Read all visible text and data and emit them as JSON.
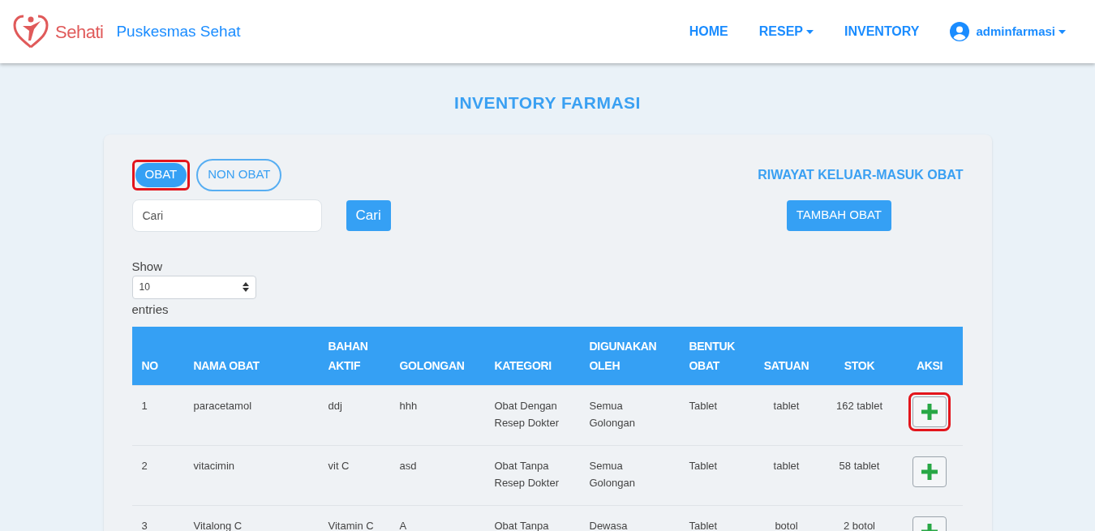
{
  "navbar": {
    "logo_text": "Sehati",
    "brand": "Puskesmas Sehat",
    "links": [
      {
        "label": "HOME",
        "dropdown": false
      },
      {
        "label": "RESEP",
        "dropdown": true
      },
      {
        "label": "INVENTORY",
        "dropdown": false
      }
    ],
    "user": {
      "label": "adminfarmasi",
      "dropdown": true
    }
  },
  "page_title": "INVENTORY FARMASI",
  "tabs": [
    {
      "label": "OBAT",
      "selected": true,
      "highlighted": true
    },
    {
      "label": "NON OBAT",
      "selected": false,
      "highlighted": false
    }
  ],
  "history_link": "RIWAYAT KELUAR-MASUK OBAT",
  "search": {
    "placeholder": "Cari",
    "button": "Cari"
  },
  "add_button": "TAMBAH OBAT",
  "length": {
    "before": "Show",
    "value": "10",
    "after": "entries"
  },
  "table": {
    "columns": [
      {
        "lines": [
          "NO"
        ]
      },
      {
        "lines": [
          "NAMA OBAT"
        ]
      },
      {
        "lines": [
          "BAHAN",
          "AKTIF"
        ]
      },
      {
        "lines": [
          "GOLONGAN"
        ]
      },
      {
        "lines": [
          "KATEGORI"
        ]
      },
      {
        "lines": [
          "DIGUNAKAN",
          "OLEH"
        ]
      },
      {
        "lines": [
          "BENTUK",
          "OBAT"
        ]
      },
      {
        "lines": [
          "SATUAN"
        ]
      },
      {
        "lines": [
          "STOK"
        ]
      },
      {
        "lines": [
          "AKSI"
        ]
      }
    ],
    "rows": [
      {
        "cells": [
          [
            "1"
          ],
          [
            "paracetamol"
          ],
          [
            "ddj"
          ],
          [
            "hhh"
          ],
          [
            "Obat Dengan",
            "Resep Dokter"
          ],
          [
            "Semua",
            "Golongan"
          ],
          [
            "Tablet"
          ],
          [
            "tablet"
          ],
          [
            "162 tablet"
          ]
        ],
        "highlighted": true
      },
      {
        "cells": [
          [
            "2"
          ],
          [
            "vitacimin"
          ],
          [
            "vit C"
          ],
          [
            "asd"
          ],
          [
            "Obat Tanpa",
            "Resep Dokter"
          ],
          [
            "Semua",
            "Golongan"
          ],
          [
            "Tablet"
          ],
          [
            "tablet"
          ],
          [
            "58 tablet"
          ]
        ],
        "highlighted": false
      },
      {
        "cells": [
          [
            "3"
          ],
          [
            "Vitalong C"
          ],
          [
            "Vitamin C"
          ],
          [
            "A"
          ],
          [
            "Obat Tanpa"
          ],
          [
            "Dewasa"
          ],
          [
            "Tablet"
          ],
          [
            "botol"
          ],
          [
            "2 botol"
          ]
        ],
        "highlighted": false
      }
    ]
  }
}
